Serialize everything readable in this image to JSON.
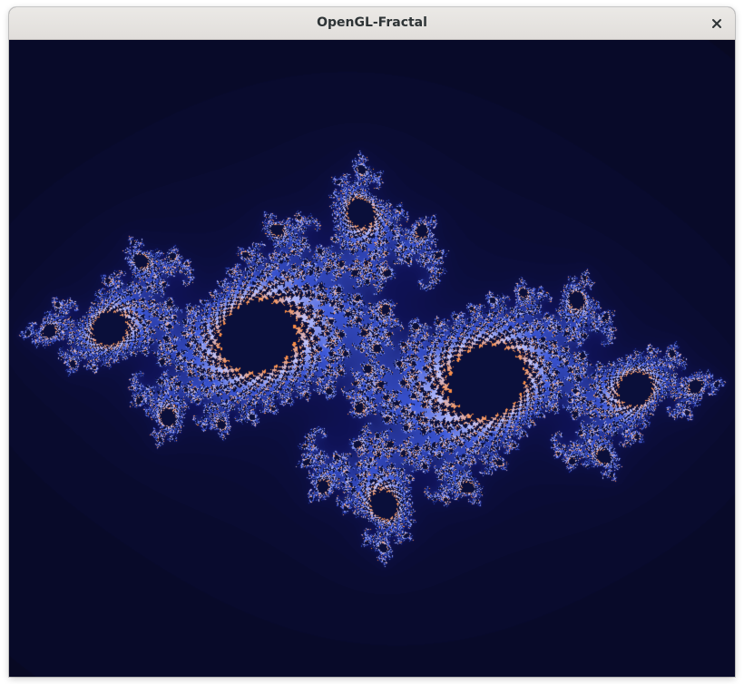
{
  "window": {
    "title": "OpenGL-Fractal"
  },
  "titlebar": {
    "close_icon": "close-icon"
  },
  "content": {
    "kind": "julia-set-render",
    "colors": {
      "background": "#050611",
      "interior": "#0a0f3a",
      "filament": "#3a56d8",
      "highlight": "#b8c4ff",
      "core": "#ff8a3a"
    }
  }
}
